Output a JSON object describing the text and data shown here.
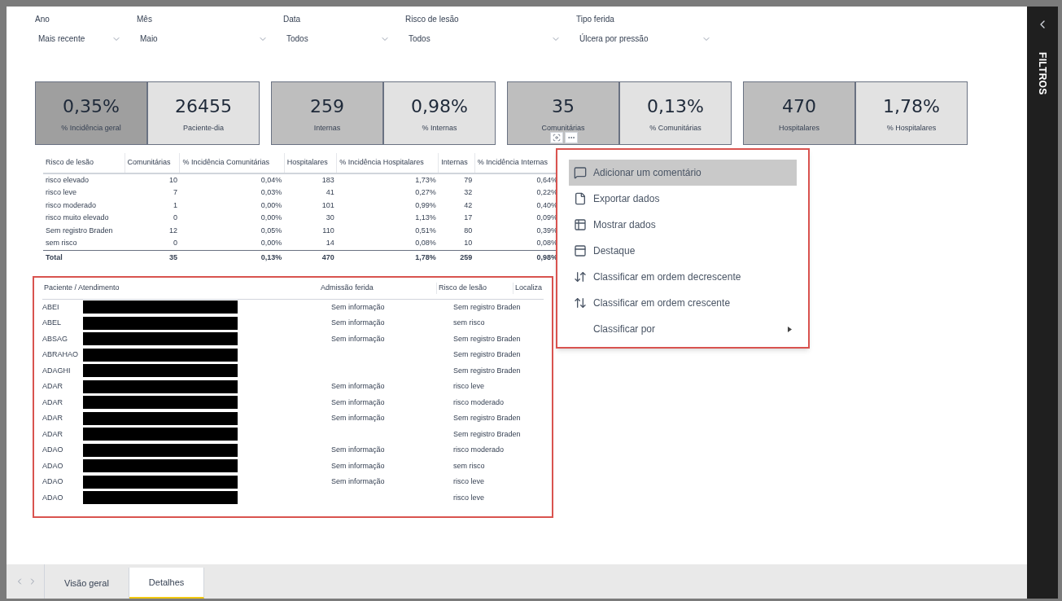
{
  "filters": [
    {
      "label": "Ano",
      "value": "Mais recente"
    },
    {
      "label": "Mês",
      "value": "Maio"
    },
    {
      "label": "Data",
      "value": "Todos"
    },
    {
      "label": "Risco de lesão",
      "value": "Todos"
    },
    {
      "label": "Tipo ferida",
      "value": "Úlcera por pressão"
    }
  ],
  "kpi_groups": [
    [
      {
        "value": "0,35%",
        "label": "% Incidência geral",
        "highlighted": true
      },
      {
        "value": "26455",
        "label": "Paciente-dia",
        "highlighted": false
      }
    ],
    [
      {
        "value": "259",
        "label": "Internas",
        "highlighted": false
      },
      {
        "value": "0,98%",
        "label": "% Internas",
        "highlighted": false
      }
    ],
    [
      {
        "value": "35",
        "label": "Comunitárias",
        "highlighted": false
      },
      {
        "value": "0,13%",
        "label": "% Comunitárias",
        "highlighted": false
      }
    ],
    [
      {
        "value": "470",
        "label": "Hospitalares",
        "highlighted": false
      },
      {
        "value": "1,78%",
        "label": "% Hospitalares",
        "highlighted": false
      }
    ]
  ],
  "matrix": {
    "columns": [
      "Risco de lesão",
      "Comunitárias",
      "% Incidência Comunitárias",
      "Hospitalares",
      "% Incidência Hospitalares",
      "Internas",
      "% Incidência Internas"
    ],
    "rows": [
      [
        "risco elevado",
        "10",
        "0,04%",
        "183",
        "1,73%",
        "79",
        "0,64%"
      ],
      [
        "risco leve",
        "7",
        "0,03%",
        "41",
        "0,27%",
        "32",
        "0,22%"
      ],
      [
        "risco moderado",
        "1",
        "0,00%",
        "101",
        "0,99%",
        "42",
        "0,40%"
      ],
      [
        "risco muito elevado",
        "0",
        "0,00%",
        "30",
        "1,13%",
        "17",
        "0,09%"
      ],
      [
        "Sem registro Braden",
        "12",
        "0,05%",
        "110",
        "0,51%",
        "80",
        "0,39%"
      ],
      [
        "sem risco",
        "0",
        "0,00%",
        "14",
        "0,08%",
        "10",
        "0,08%"
      ]
    ],
    "total": [
      "Total",
      "35",
      "0,13%",
      "470",
      "1,78%",
      "259",
      "0,98%"
    ]
  },
  "patients": {
    "columns": [
      "Paciente / Atendimento",
      "Admissão ferida",
      "Risco de lesão",
      "Localiza"
    ],
    "rows": [
      {
        "patient": "ABEI",
        "admission": "Sem informação",
        "risk": "Sem registro Braden"
      },
      {
        "patient": "ABEL",
        "admission": "Sem informação",
        "risk": "sem risco"
      },
      {
        "patient": "ABSAG",
        "admission": "Sem informação",
        "risk": "Sem registro Braden"
      },
      {
        "patient": "ABRAHAO",
        "risk": "Sem registro Braden"
      },
      {
        "patient": "ADAGHI",
        "risk": "Sem registro Braden"
      },
      {
        "patient": "ADAR",
        "admission": "Sem informação",
        "risk": "risco leve"
      },
      {
        "patient": "ADAR",
        "admission": "Sem informação",
        "risk": "risco moderado"
      },
      {
        "patient": "ADAR",
        "admission": "Sem informação",
        "risk": "Sem registro Braden"
      },
      {
        "patient": "ADAR",
        "risk": "Sem registro Braden"
      },
      {
        "patient": "ADAO",
        "admission": "Sem informação",
        "risk": "risco moderado"
      },
      {
        "patient": "ADAO",
        "admission": "Sem informação",
        "risk": "sem risco"
      },
      {
        "patient": "ADAO",
        "admission": "Sem informação",
        "risk": "risco leve"
      },
      {
        "patient": "ADAO",
        "risk": "risco leve"
      }
    ]
  },
  "context_menu": [
    {
      "label": "Adicionar um comentário",
      "kind": "comment",
      "selected": true
    },
    {
      "label": "Exportar dados",
      "kind": "export",
      "selected": false
    },
    {
      "label": "Mostrar dados",
      "kind": "show",
      "selected": false
    },
    {
      "label": "Destaque",
      "kind": "spotlight",
      "selected": false
    },
    {
      "label": "Classificar em ordem decrescente",
      "kind": "sort-desc",
      "selected": false
    },
    {
      "label": "Classificar em ordem crescente",
      "kind": "sort-asc",
      "selected": false
    },
    {
      "label": "Classificar por",
      "kind": "submenu",
      "selected": false
    }
  ],
  "filters_pane": {
    "title": "FILTROS"
  },
  "page_tabs": [
    {
      "label": "Visão geral",
      "selected": false
    },
    {
      "label": "Detalhes",
      "selected": true
    }
  ]
}
